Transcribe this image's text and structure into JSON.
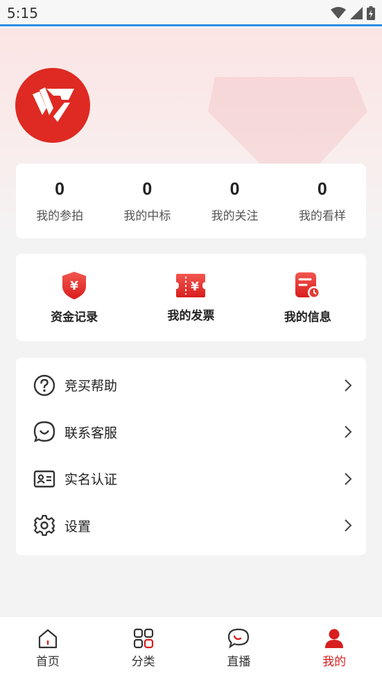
{
  "status_bar": {
    "time": "5:15"
  },
  "stats": [
    {
      "value": "0",
      "label": "我的参拍"
    },
    {
      "value": "0",
      "label": "我的中标"
    },
    {
      "value": "0",
      "label": "我的关注"
    },
    {
      "value": "0",
      "label": "我的看样"
    }
  ],
  "quick_actions": [
    {
      "label": "资金记录",
      "icon": "funds-shield-icon"
    },
    {
      "label": "我的发票",
      "icon": "invoice-ticket-icon"
    },
    {
      "label": "我的信息",
      "icon": "info-doc-icon"
    }
  ],
  "menu": [
    {
      "label": "竞买帮助",
      "icon": "help-circle-icon"
    },
    {
      "label": "联系客服",
      "icon": "chat-smile-icon"
    },
    {
      "label": "实名认证",
      "icon": "id-card-icon"
    },
    {
      "label": "设置",
      "icon": "gear-icon"
    }
  ],
  "tabbar": [
    {
      "label": "首页",
      "icon": "home-icon"
    },
    {
      "label": "分类",
      "icon": "grid-icon"
    },
    {
      "label": "直播",
      "icon": "live-chat-icon"
    },
    {
      "label": "我的",
      "icon": "user-icon",
      "active": true
    }
  ],
  "colors": {
    "accent": "#d81e1e",
    "status_bar_line": "#2f8de6",
    "logo": "#de2a22"
  }
}
